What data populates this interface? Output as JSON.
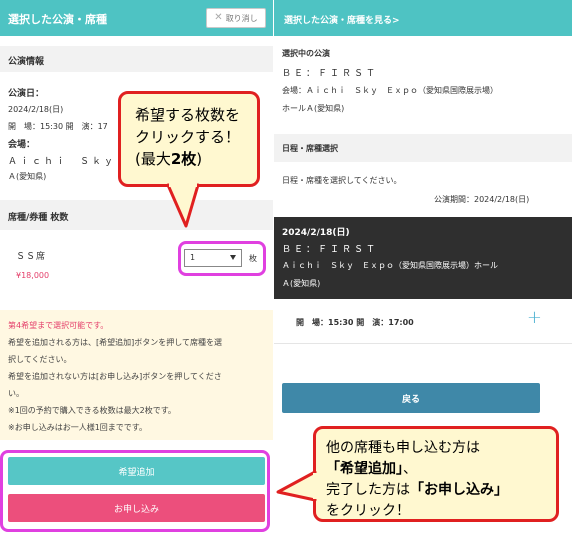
{
  "left_panel": {
    "header_title": "選択した公演・席種",
    "cancel_label": "取り消し",
    "section_performance": "公演情報",
    "date_label": "公演日：",
    "date_value": "2024/2/18(日)",
    "times_text": "開　場：15:30 開　演：17",
    "venue_label": "会場：",
    "venue_value_line1": "Ａｉｃｈｉ　Ｓｋｙ　Ｅｘ",
    "venue_value_line2": "Ａ(愛知県)",
    "section_seat": "席種/券種 枚数",
    "seat_name": "ＳＳ席",
    "seat_price": "¥18,000",
    "quantity_value": "1",
    "quantity_unit": "枚",
    "notice_line1": "第4希望まで選択可能です。",
    "notice_line2": "希望を追加される方は、[希望追加]ボタンを押して席種を選",
    "notice_line3": "択してください。",
    "notice_line4": "希望を追加されない方は[お申し込み]ボタンを押してくださ",
    "notice_line5": "い。",
    "notice_line6": "※1回の予約で購入できる枚数は最大2枚です。",
    "notice_line7": "※お申し込みはお一人様1回までです。",
    "add_button": "希望追加",
    "apply_button": "お申し込み"
  },
  "right_panel": {
    "header_link": "選択した公演・席種を見る>",
    "selected_heading": "選択中の公演",
    "artist": "ＢＥ：ＦＩＲＳＴ",
    "venue_line1": "会場：Ａｉｃｈｉ　Ｓｋｙ　Ｅｘｐｏ（愛知県国際展示場）",
    "venue_line2": "ホールＡ(愛知県)",
    "section_schedule": "日程・席種選択",
    "schedule_instruction": "日程・席種を選択してください。",
    "period": "公演期間：2024/2/18(日)",
    "card_date": "2024/2/18(日)",
    "card_artist": "ＢＥ：ＦＩＲＳＴ",
    "card_venue_line1": "Ａｉｃｈｉ　Ｓｋｙ　Ｅｘｐｏ（愛知県国際展示場）ホール",
    "card_venue_line2": "Ａ(愛知県)",
    "card_times": "開　場：15:30 開　演：17:00",
    "back_button": "戻る"
  },
  "callouts": {
    "c1_line1": "希望する枚数を",
    "c1_line2": "クリックする！",
    "c1_line3_pre": "(最大",
    "c1_line3_bold": "2枚",
    "c1_line3_post": ")",
    "c2_line1": "他の席種も申し込む方は",
    "c2_line2_bold": "「希望追加」",
    "c2_line2_post": "、",
    "c2_line3_pre": "完了した方は",
    "c2_line3_bold": "「お申し込み」",
    "c2_line4": "をクリック！"
  },
  "colors": {
    "header_teal": "#4ec3c3",
    "button_teal": "#56c6c6",
    "button_pink": "#ec4f7c",
    "button_blue": "#3f88a8",
    "highlight_magenta": "#e040e0",
    "callout_border": "#e02020",
    "callout_fill": "#fff8d0"
  }
}
